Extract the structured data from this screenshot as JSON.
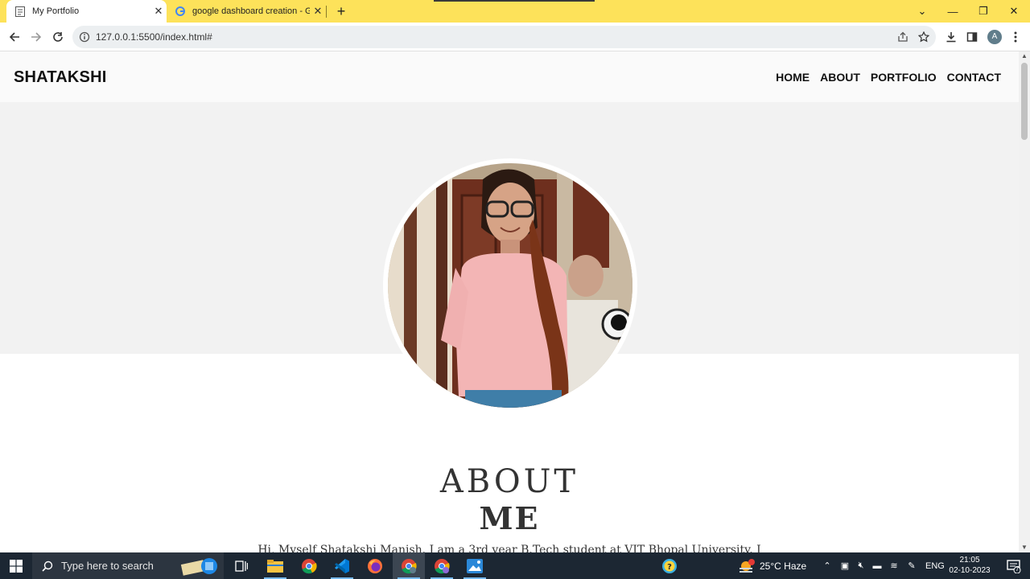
{
  "browser": {
    "tabs": [
      {
        "title": "My Portfolio",
        "active": true
      },
      {
        "title": "google dashboard creation - Go",
        "active": false
      }
    ],
    "url": "127.0.0.1:5500/index.html#",
    "profile_initial": "A"
  },
  "site": {
    "logo": "SHATAKSHI",
    "nav": [
      "HOME",
      "ABOUT",
      "PORTFOLIO",
      "CONTACT"
    ],
    "about_title": "ABOUT",
    "about_subtitle": "ME",
    "about_text": "Hi, Myself Shatakshi Manish. I am a 3rd year B.Tech student at VIT Bhopal University. I"
  },
  "taskbar": {
    "search_placeholder": "Type here to search",
    "weather": "25°C  Haze",
    "language": "ENG",
    "time": "21:05",
    "date": "02-10-2023",
    "notification_count": "7"
  },
  "colors": {
    "tab_strip": "#fde25a",
    "hero_bg": "#f2f2f2",
    "taskbar_bg": "#1c2733"
  }
}
